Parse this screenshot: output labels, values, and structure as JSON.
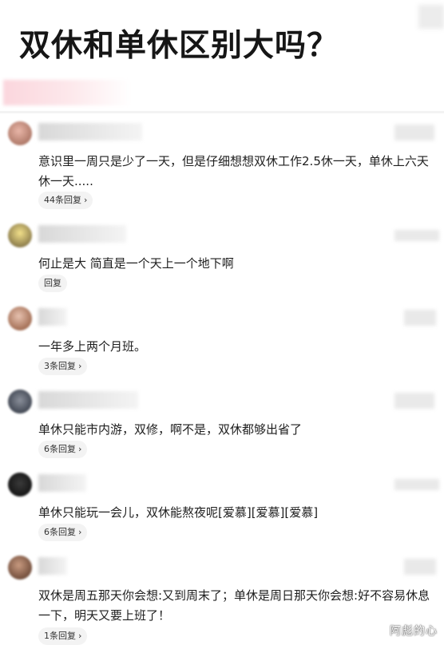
{
  "header": {
    "title": "双休和单休区别大吗？"
  },
  "comments": [
    {
      "text": "意识里一周只是少了一天，但是仔细想想双休工作2.5休一天，单休上六天休一天.....",
      "reply": "44条回复"
    },
    {
      "text": "何止是大 简直是一个天上一个地下啊",
      "reply": "回复"
    },
    {
      "text": "一年多上两个月班。",
      "reply": "3条回复"
    },
    {
      "text": "单休只能市内游，双修，啊不是，双休都够出省了",
      "reply": "6条回复"
    },
    {
      "text": "单休只能玩一会儿，双休能熬夜呢[爱慕][爱慕][爱慕]",
      "reply": "6条回复"
    },
    {
      "text": "双休是周五那天你会想:又到周末了；单休是周日那天你会想:好不容易休息一下，明天又要上班了！",
      "reply": "1条回复"
    }
  ],
  "icons": {
    "reply_chevron": "chevron-right-icon"
  },
  "watermark": "阿彪的心",
  "colors": {
    "reply_pill_bg": "#f3f3f3",
    "accent_blur": "#fbd6dd"
  }
}
